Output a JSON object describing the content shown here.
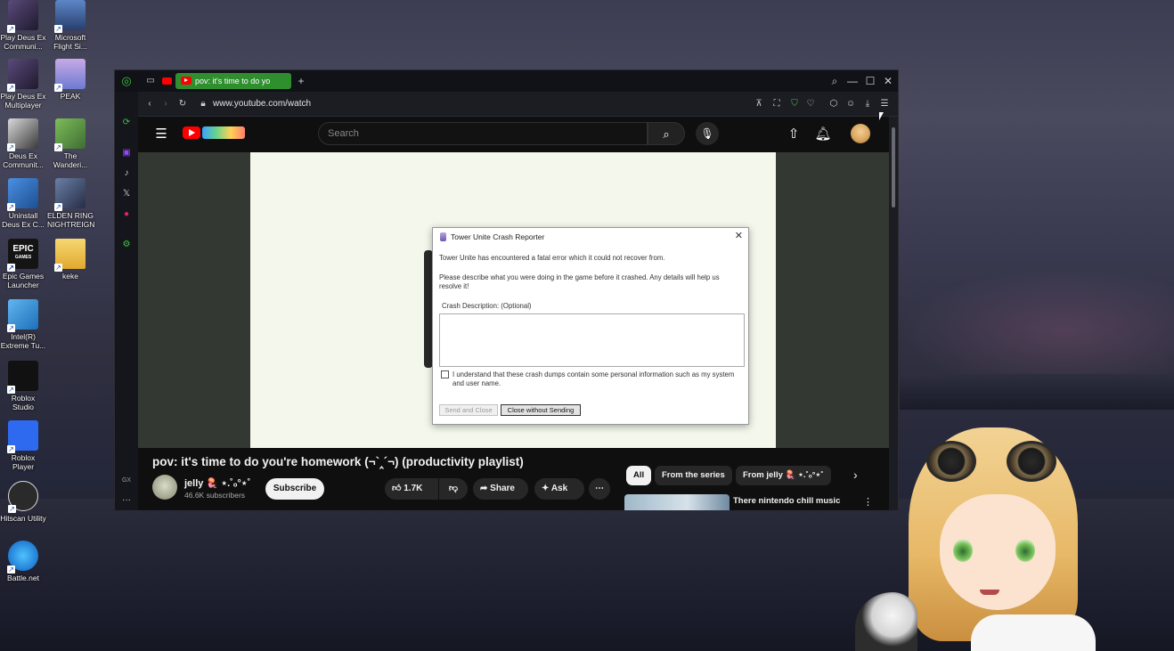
{
  "desktop": {
    "icons": [
      {
        "label": "Play Deus Ex Communi...",
        "icon": "deus-ex-icon"
      },
      {
        "label": "Microsoft Flight Si...",
        "icon": "flight-sim-icon"
      },
      {
        "label": "Play Deus Ex Multiplayer",
        "icon": "deus-ex-icon"
      },
      {
        "label": "PEAK",
        "icon": "peak-icon"
      },
      {
        "label": "Deus Ex Communit...",
        "icon": "deus-ex-icon"
      },
      {
        "label": "The Wanderi...",
        "icon": "wanderer-icon"
      },
      {
        "label": "Uninstall Deus Ex C...",
        "icon": "uninstall-icon"
      },
      {
        "label": "ELDEN RING NIGHTREIGN",
        "icon": "elden-ring-icon"
      },
      {
        "label": "Epic Games Launcher",
        "icon": "epic-games-icon"
      },
      {
        "label": "keke",
        "icon": "folder-icon"
      },
      {
        "label": "Intel(R) Extreme Tu...",
        "icon": "intel-icon"
      },
      {
        "label": "Roblox Studio",
        "icon": "roblox-studio-icon"
      },
      {
        "label": "Roblox Player",
        "icon": "roblox-player-icon"
      },
      {
        "label": "Hitscan Utility",
        "icon": "hitscan-icon"
      },
      {
        "label": "Battle.net",
        "icon": "battlenet-icon"
      }
    ],
    "epic_logo": "EPIC",
    "epic_logo_sub": "GAMES"
  },
  "browser": {
    "tab_title": "pov: it's time to do yo",
    "url": "www.youtube.com/watch",
    "new_tab": "+",
    "sidebar_gx": "GX",
    "sidebar_more": "···",
    "accent": "#2f8f2f"
  },
  "youtube": {
    "search_placeholder": "Search",
    "video_title": "pov: it's time to do you're homework (¬`‸´¬) (productivity playlist)",
    "channel_name": "jelly 🪼 ⋆.˚ₒ°⋆˚",
    "subscribers": "46.6K subscribers",
    "subscribe_label": "Subscribe",
    "likes": "1.7K",
    "share_label": "Share",
    "ask_label": "Ask",
    "chips": [
      "All",
      "From the series",
      "From jelly 🪼 ⋆.˚ₒ°⋆˚"
    ],
    "rec_title": "There nintendo chill music"
  },
  "crash_dialog": {
    "title": "Tower Unite Crash Reporter",
    "line1": "Tower Unite has encountered a fatal error which it could not recover from.",
    "line2": "Please describe what you were doing in the game before it crashed. Any details will help us resolve it!",
    "description_label": "Crash Description: (Optional)",
    "description_value": "",
    "checkbox_label": "I understand that these crash dumps contain some personal information such as my system and user name.",
    "checkbox_checked": false,
    "send_button": "Send and Close",
    "close_button": "Close without Sending"
  }
}
